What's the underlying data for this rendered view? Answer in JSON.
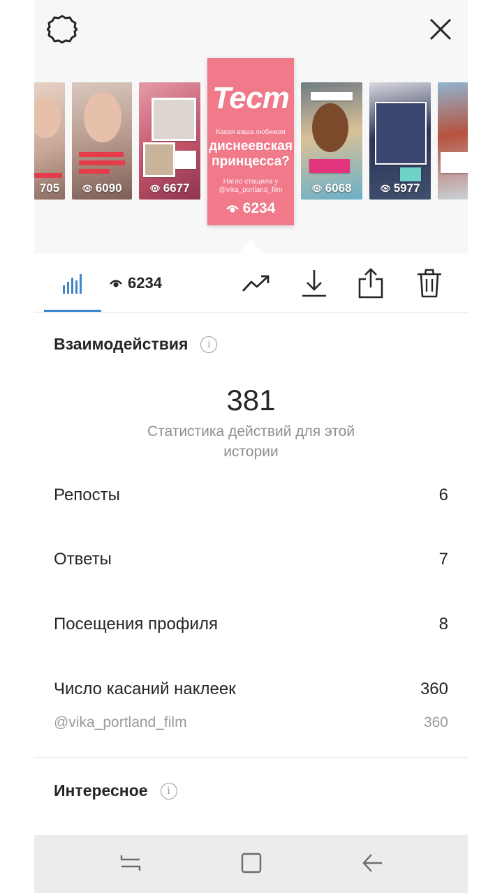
{
  "stories": [
    {
      "views": "705"
    },
    {
      "views": "6090"
    },
    {
      "views": "6677"
    },
    {
      "views": "6068"
    },
    {
      "views": "5977"
    }
  ],
  "featured_story": {
    "title": "Тест",
    "subtitle": "Какая ваша любимая",
    "headline": "диснеевская принцесса?",
    "note": "Нагло стащила у @vika_portland_film",
    "views": "6234",
    "color": "#f0798a"
  },
  "toolbar": {
    "views_count": "6234",
    "active_tab_color": "#3f87cc",
    "icons": [
      "insights-bars-icon",
      "eye-icon",
      "trend-icon",
      "download-icon",
      "share-icon",
      "trash-icon"
    ]
  },
  "interactions": {
    "title": "Взаимодействия",
    "total": "381",
    "description": "Статистика действий для этой истории",
    "rows": [
      {
        "label": "Репосты",
        "value": "6"
      },
      {
        "label": "Ответы",
        "value": "7"
      },
      {
        "label": "Посещения профиля",
        "value": "8"
      },
      {
        "label": "Число касаний наклеек",
        "value": "360"
      }
    ],
    "sub_rows": [
      {
        "label": "@vika_portland_film",
        "value": "360"
      }
    ]
  },
  "discovery": {
    "title": "Интересное"
  },
  "header_icons": [
    "settings-gear-icon",
    "close-icon"
  ],
  "nav_icons": [
    "recents-icon",
    "home-icon",
    "back-icon"
  ]
}
